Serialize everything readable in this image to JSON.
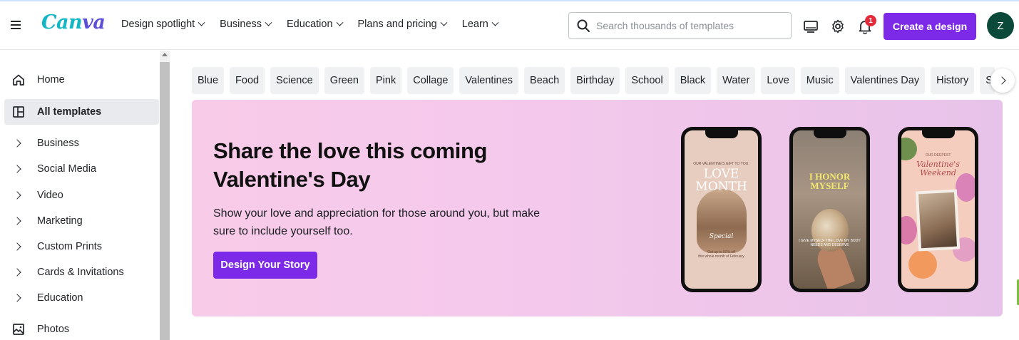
{
  "header": {
    "logo": [
      "Can",
      "va"
    ],
    "nav": [
      {
        "label": "Design spotlight"
      },
      {
        "label": "Business"
      },
      {
        "label": "Education"
      },
      {
        "label": "Plans and pricing"
      },
      {
        "label": "Learn"
      }
    ],
    "search_placeholder": "Search thousands of templates",
    "notification_count": "1",
    "create_button": "Create a design",
    "avatar_initial": "Z",
    "icons": [
      "menu-icon",
      "desktop-icon",
      "settings-icon",
      "bell-icon"
    ]
  },
  "sidebar": {
    "items": [
      {
        "label": "Home",
        "icon": "home-icon"
      },
      {
        "label": "All templates",
        "icon": "templates-icon"
      },
      {
        "label": "Business",
        "icon": "chevron-right-icon"
      },
      {
        "label": "Social Media",
        "icon": "chevron-right-icon"
      },
      {
        "label": "Video",
        "icon": "chevron-right-icon"
      },
      {
        "label": "Marketing",
        "icon": "chevron-right-icon"
      },
      {
        "label": "Custom Prints",
        "icon": "chevron-right-icon"
      },
      {
        "label": "Cards & Invitations",
        "icon": "chevron-right-icon"
      },
      {
        "label": "Education",
        "icon": "chevron-right-icon"
      },
      {
        "label": "Photos",
        "icon": "image-icon"
      }
    ]
  },
  "chips": [
    "Blue",
    "Food",
    "Science",
    "Green",
    "Pink",
    "Collage",
    "Valentines",
    "Beach",
    "Birthday",
    "School",
    "Black",
    "Water",
    "Love",
    "Music",
    "Valentines Day",
    "History",
    "Sports"
  ],
  "banner": {
    "title_line1": "Share the love this coming",
    "title_line2": "Valentine's Day",
    "body_line1": "Show your love and appreciation for those around you, but make",
    "body_line2": "sure to include yourself too.",
    "button": "Design Your Story",
    "phones": [
      {
        "top_text": "OUR VALENTINE'S GIFT TO YOU:",
        "big_text": [
          "LOVE",
          "MONTH"
        ],
        "script": "Special",
        "bottom_text": [
          "Get up to 50% off",
          "this whole month of February"
        ]
      },
      {
        "big_text": [
          "I HONOR",
          "MYSELF"
        ],
        "small_text": [
          "I GIVE MYSELF THE LOVE MY BODY",
          "NEEDS AND DESERVE"
        ]
      },
      {
        "top_text": "OUR DEEPEST",
        "title": [
          "Valentine's",
          "Weekend"
        ]
      }
    ]
  },
  "colors": {
    "accent": "#7d2ae8",
    "logo_teal": "#12b6c4",
    "logo_purple": "#5d4fd8",
    "avatar": "#0b4a3a",
    "badge": "#e32b3b"
  }
}
